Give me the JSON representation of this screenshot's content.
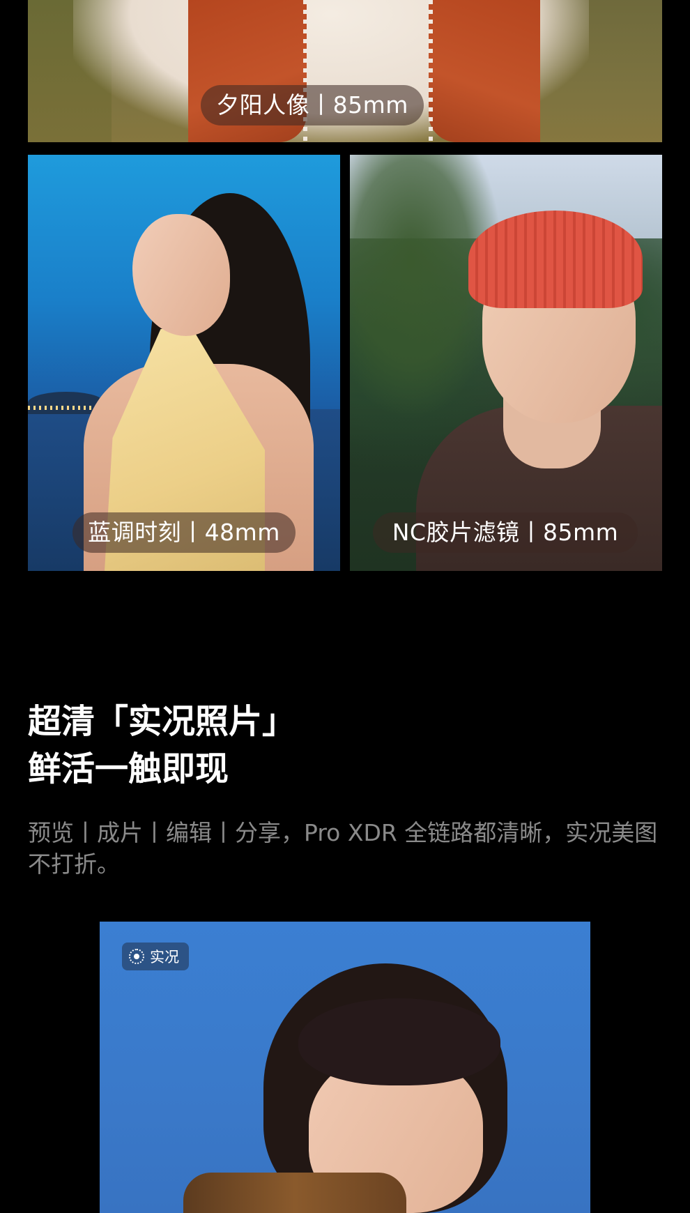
{
  "gallery": {
    "sunset": {
      "caption": "夕阳人像丨85mm"
    },
    "blue_hour": {
      "caption": "蓝调时刻丨48mm"
    },
    "nc_film": {
      "caption": "NC胶片滤镜丨85mm"
    }
  },
  "section": {
    "title_line1": "超清「实况照片」",
    "title_line2": "鲜活一触即现",
    "description": "预览丨成片丨编辑丨分享，Pro XDR 全链路都清晰，实况美图不打折。"
  },
  "live_photo": {
    "badge_label": "实况",
    "badge_icon": "live-photo-icon"
  }
}
